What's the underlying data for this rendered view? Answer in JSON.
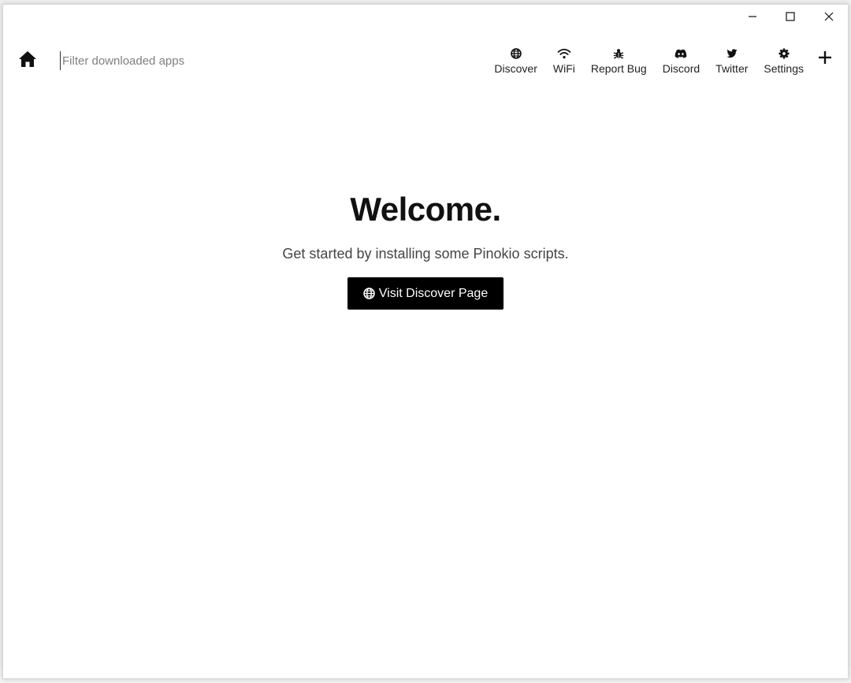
{
  "window": {
    "controls": {
      "minimize_icon": "minimize-icon",
      "maximize_icon": "maximize-icon",
      "close_icon": "close-icon"
    }
  },
  "topbar": {
    "home_icon": "home-icon",
    "search": {
      "placeholder": "Filter downloaded apps",
      "value": ""
    },
    "nav_items": [
      {
        "label": "Discover",
        "icon": "globe-icon"
      },
      {
        "label": "WiFi",
        "icon": "wifi-icon"
      },
      {
        "label": "Report Bug",
        "icon": "bug-icon"
      },
      {
        "label": "Discord",
        "icon": "discord-icon"
      },
      {
        "label": "Twitter",
        "icon": "twitter-icon"
      },
      {
        "label": "Settings",
        "icon": "gear-icon"
      }
    ],
    "add_icon": "plus-icon"
  },
  "main": {
    "title": "Welcome.",
    "subtitle": "Get started by installing some Pinokio scripts.",
    "cta": {
      "label": "Visit Discover Page",
      "icon": "globe-icon"
    }
  },
  "colors": {
    "window_bg": "#ffffff",
    "text": "#222222",
    "button_bg": "#000000",
    "button_text": "#ffffff",
    "placeholder": "#808080"
  }
}
